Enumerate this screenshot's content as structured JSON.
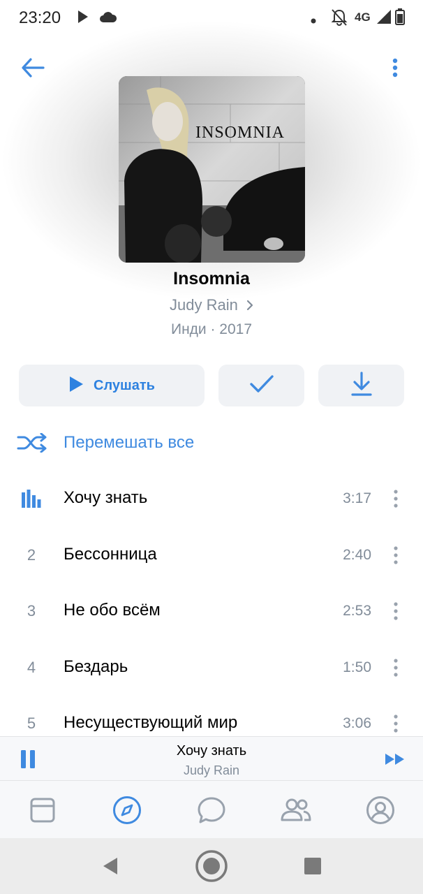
{
  "status_bar": {
    "time": "23:20",
    "network": "4G",
    "icons": [
      "play-icon",
      "cloud-icon",
      "dot-icon",
      "notifications-off-icon",
      "signal-icon",
      "battery-icon"
    ]
  },
  "header": {
    "back_icon": "back-arrow-icon",
    "more_icon": "more-vertical-icon"
  },
  "album": {
    "cover_text": "INSOMNIA",
    "title": "Insomnia",
    "artist": "Judy Rain",
    "genre_year": "Инди · 2017"
  },
  "actions": {
    "play_label": "Слушать",
    "added_icon": "check-icon",
    "download_icon": "download-icon"
  },
  "shuffle": {
    "label": "Перемешать все",
    "icon": "shuffle-icon"
  },
  "tracks": [
    {
      "num": "",
      "playing": true,
      "title": "Хочу знать",
      "duration": "3:17"
    },
    {
      "num": "2",
      "playing": false,
      "title": "Бессонница",
      "duration": "2:40"
    },
    {
      "num": "3",
      "playing": false,
      "title": "Не обо всём",
      "duration": "2:53"
    },
    {
      "num": "4",
      "playing": false,
      "title": "Бездарь",
      "duration": "1:50"
    },
    {
      "num": "5",
      "playing": false,
      "title": "Несуществующий мир",
      "duration": "3:06"
    }
  ],
  "mini_player": {
    "title": "Хочу знать",
    "artist": "Judy Rain",
    "pause_icon": "pause-icon",
    "next_icon": "next-icon"
  },
  "tab_bar": {
    "tabs": [
      "news-icon",
      "explore-icon",
      "messages-icon",
      "friends-icon",
      "profile-icon"
    ],
    "active": "explore-icon"
  },
  "colors": {
    "accent": "#3f8ae0",
    "secondary_text": "#818c99",
    "button_bg": "#f0f2f5"
  }
}
